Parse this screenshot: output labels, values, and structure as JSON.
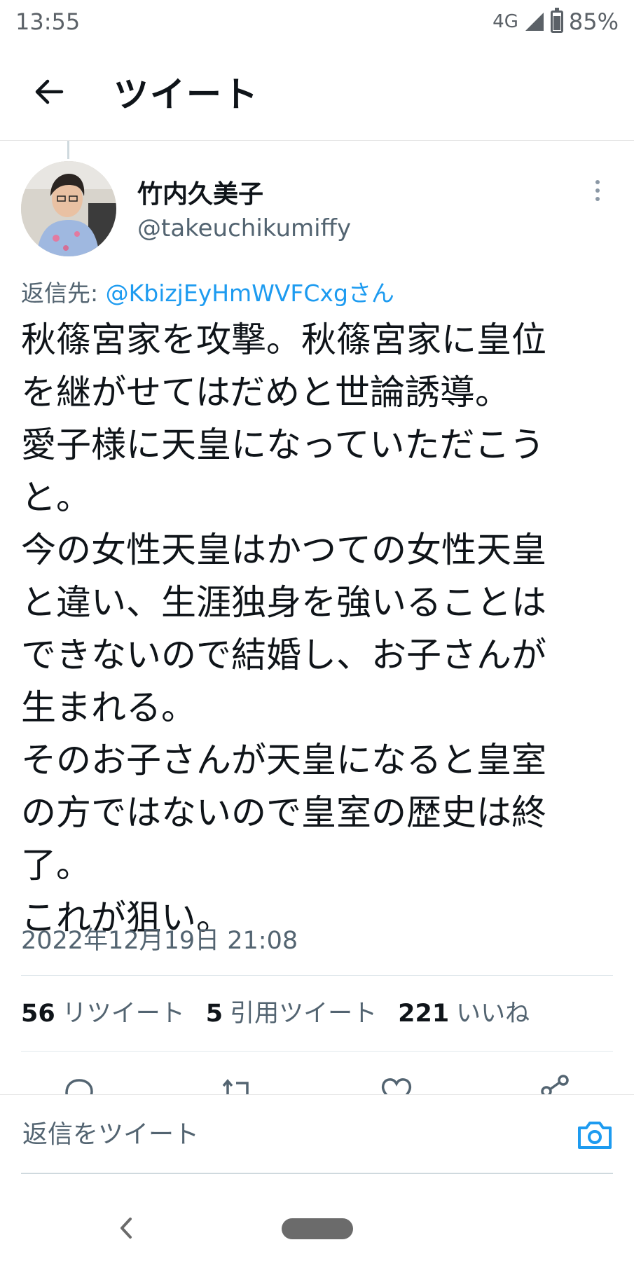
{
  "status_bar": {
    "time": "13:55",
    "network": "4G",
    "battery": "85%"
  },
  "header": {
    "title": "ツイート"
  },
  "tweet": {
    "author_name": "竹内久美子",
    "author_handle": "@takeuchikumiffy",
    "reply_prefix": "返信先: ",
    "reply_mention": "@KbizjEyHmWVFCxgさん",
    "text": "秋篠宮家を攻撃。秋篠宮家に皇位\nを継がせてはだめと世論誘導。\n愛子様に天皇になっていただこう\nと。\n今の女性天皇はかつての女性天皇\nと違い、生涯独身を強いることは\nできないので結婚し、お子さんが\n生まれる。\nそのお子さんが天皇になると皇室\nの方ではないので皇室の歴史は終\n了。\nこれが狙い。",
    "timestamp": "2022年12月19日 21:08"
  },
  "stats": {
    "retweets_count": "56",
    "retweets_label": "リツイート",
    "quotes_count": "5",
    "quotes_label": "引用ツイート",
    "likes_count": "221",
    "likes_label": "いいね"
  },
  "reply_bar": {
    "placeholder": "返信をツイート"
  },
  "colors": {
    "accent": "#1d9bf0",
    "text": "#0f1419",
    "secondary": "#536471"
  },
  "icons": [
    "back-arrow-icon",
    "more-vertical-icon",
    "reply-icon",
    "retweet-icon",
    "like-icon",
    "share-icon",
    "camera-icon",
    "nav-back-icon"
  ]
}
